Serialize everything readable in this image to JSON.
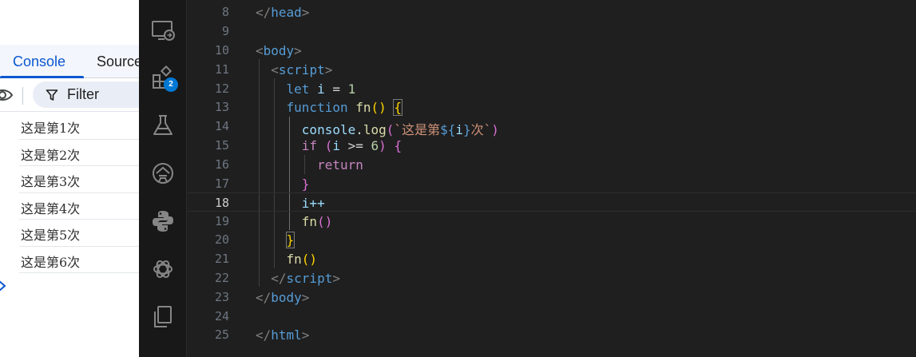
{
  "devtools": {
    "tabs": {
      "console": "Console",
      "sources": "Sources"
    },
    "filter_label": "Filter",
    "logs": [
      "这是第1次",
      "这是第2次",
      "这是第3次",
      "这是第4次",
      "这是第5次",
      "这是第6次"
    ]
  },
  "activity_bar": {
    "icons": [
      "remote-explorer-icon",
      "extensions-icon",
      "testing-flask-icon",
      "live-share-icon",
      "python-icon",
      "openai-icon",
      "copy-files-icon"
    ],
    "extensions_badge": "2"
  },
  "editor": {
    "line_numbers": [
      "8",
      "9",
      "10",
      "11",
      "12",
      "13",
      "14",
      "15",
      "16",
      "17",
      "18",
      "19",
      "20",
      "21",
      "22",
      "23",
      "24",
      "25"
    ],
    "active_line": "18",
    "tokens": {
      "lt": "<",
      "lt_slash": "</",
      "gt": ">",
      "head": "head",
      "body": "body",
      "script": "script",
      "html": "html",
      "let": "let",
      "i": "i",
      "eq": " = ",
      "one": "1",
      "function": "function",
      "fn": "fn",
      "paren_open": "(",
      "paren_close": ")",
      "parens": "()",
      "brace_open": "{",
      "brace_close": "}",
      "console": "console",
      "dot": ".",
      "log": "log",
      "backtick": "`",
      "template_text": "这是第",
      "template_open": "${",
      "template_tail": "次",
      "if": "if",
      "gte": " >= ",
      "six": "6",
      "return": "return",
      "incr": "i++"
    }
  }
}
